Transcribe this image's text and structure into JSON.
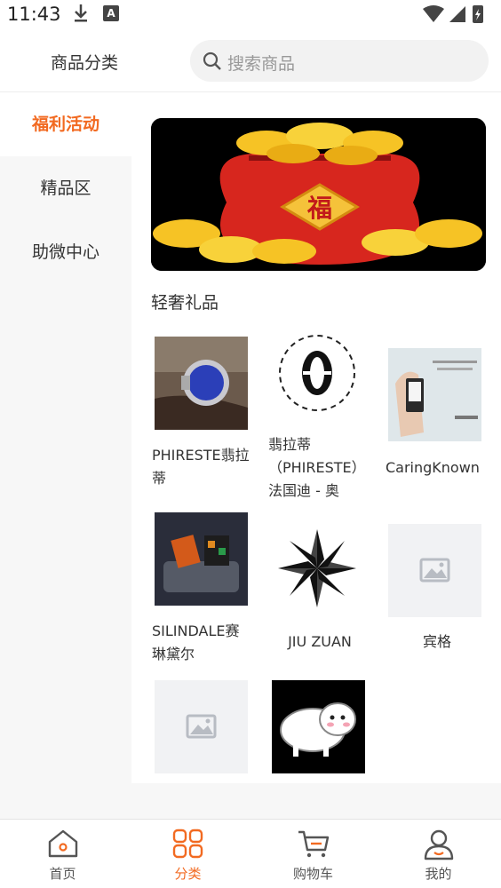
{
  "status_bar": {
    "time": "11:43",
    "ab_glyph": "A"
  },
  "header": {
    "title": "商品分类",
    "search_placeholder": "搜索商品"
  },
  "sidebar": {
    "items": [
      {
        "label": "福利活动",
        "active": true
      },
      {
        "label": "精品区",
        "active": false
      },
      {
        "label": "助微中心",
        "active": false
      }
    ]
  },
  "banner": {
    "text": "福"
  },
  "section": {
    "title": "轻奢礼品"
  },
  "products": [
    {
      "name": "PHIRESTE翡拉蒂",
      "image": "watch-image"
    },
    {
      "name": "翡拉蒂（PHIRESTE）法国迪 - 奥",
      "image": "brand-logo-ring"
    },
    {
      "name": "CaringKnown",
      "image": "watch-image"
    },
    {
      "name": "SILINDALE赛琳黛尔",
      "image": "bags-image"
    },
    {
      "name": "JIU ZUAN",
      "image": "brand-logo-star"
    },
    {
      "name": "宾格",
      "image": "image-placeholder"
    },
    {
      "name": "",
      "image": "image-placeholder"
    },
    {
      "name": "",
      "image": "sheep-image"
    }
  ],
  "tabbar": {
    "tabs": [
      {
        "label": "首页",
        "icon": "home-icon",
        "active": false
      },
      {
        "label": "分类",
        "icon": "category-icon",
        "active": true
      },
      {
        "label": "购物车",
        "icon": "cart-icon",
        "active": false
      },
      {
        "label": "我的",
        "icon": "profile-icon",
        "active": false
      }
    ]
  },
  "colors": {
    "accent": "#f26a21",
    "sidebar_bg": "#f7f7f7",
    "search_bg": "#f2f2f2"
  }
}
